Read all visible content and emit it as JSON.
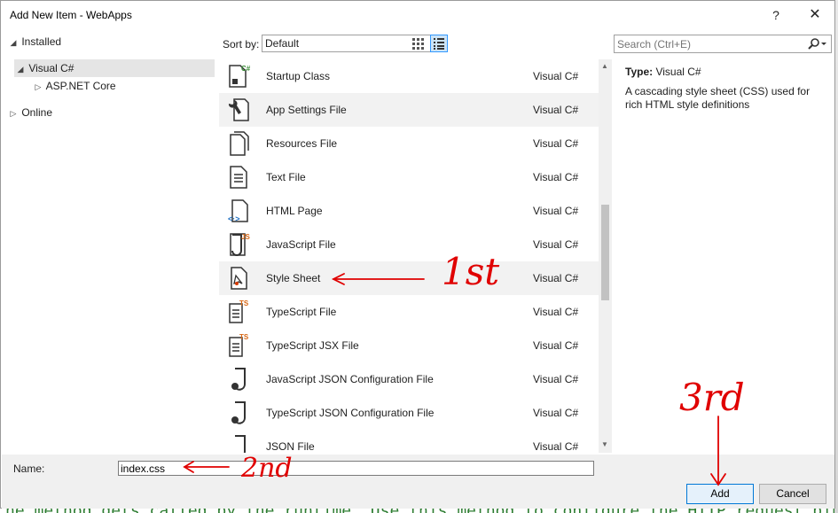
{
  "window": {
    "title": "Add New Item - WebApps",
    "help_glyph": "?",
    "close_glyph": "✕"
  },
  "tree": {
    "installed": "Installed",
    "visual_csharp": "Visual C#",
    "aspnet_core": "ASP.NET Core",
    "online": "Online"
  },
  "toolbar": {
    "sort_label": "Sort by:",
    "sort_value": "Default"
  },
  "search": {
    "placeholder": "Search (Ctrl+E)"
  },
  "templates": [
    {
      "name": "Startup Class",
      "lang": "Visual C#",
      "icon": "startup-class-icon"
    },
    {
      "name": "App Settings File",
      "lang": "Visual C#",
      "icon": "app-settings-icon"
    },
    {
      "name": "Resources File",
      "lang": "Visual C#",
      "icon": "resources-file-icon"
    },
    {
      "name": "Text File",
      "lang": "Visual C#",
      "icon": "text-file-icon"
    },
    {
      "name": "HTML Page",
      "lang": "Visual C#",
      "icon": "html-page-icon"
    },
    {
      "name": "JavaScript File",
      "lang": "Visual C#",
      "icon": "javascript-file-icon"
    },
    {
      "name": "Style Sheet",
      "lang": "Visual C#",
      "icon": "style-sheet-icon"
    },
    {
      "name": "TypeScript File",
      "lang": "Visual C#",
      "icon": "typescript-file-icon"
    },
    {
      "name": "TypeScript JSX File",
      "lang": "Visual C#",
      "icon": "typescript-jsx-icon"
    },
    {
      "name": "JavaScript JSON Configuration File",
      "lang": "Visual C#",
      "icon": "json-config-icon"
    },
    {
      "name": "TypeScript JSON Configuration File",
      "lang": "Visual C#",
      "icon": "json-config-icon"
    },
    {
      "name": "JSON File",
      "lang": "Visual C#",
      "icon": "json-file-icon"
    }
  ],
  "details": {
    "type_label": "Type:",
    "type_value": "Visual C#",
    "description": "A cascading style sheet (CSS) used for rich HTML style definitions"
  },
  "bottom": {
    "name_label": "Name:",
    "name_value": "index.css",
    "add_label": "Add",
    "cancel_label": "Cancel"
  },
  "annotations": {
    "first": "1st",
    "second": "2nd",
    "third": "3rd"
  },
  "background": {
    "code_text": "he method gets called by the runtime. Use this method to configure the HTTP request pip"
  },
  "colors": {
    "selection": "#e5e5e5",
    "annotation": "#e00000",
    "accent": "#0078d7"
  }
}
